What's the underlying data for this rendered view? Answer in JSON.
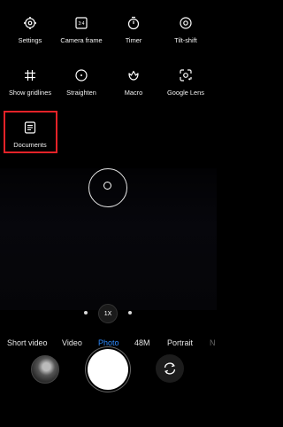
{
  "settings_grid": {
    "row1": [
      {
        "label": "Settings",
        "icon": "gear-icon"
      },
      {
        "label": "Camera frame",
        "icon": "aspect-ratio-icon",
        "icon_text": "3:4"
      },
      {
        "label": "Timer",
        "icon": "timer-icon"
      },
      {
        "label": "Tilt-shift",
        "icon": "tilt-shift-icon"
      }
    ],
    "row2": [
      {
        "label": "Show gridlines",
        "icon": "grid-icon"
      },
      {
        "label": "Straighten",
        "icon": "straighten-icon"
      },
      {
        "label": "Macro",
        "icon": "macro-flower-icon"
      },
      {
        "label": "Google Lens",
        "icon": "google-lens-icon"
      }
    ],
    "row3": [
      {
        "label": "Documents",
        "icon": "document-icon"
      }
    ]
  },
  "zoom": {
    "label": "1X"
  },
  "modes": {
    "items": [
      "Short video",
      "Video",
      "Photo",
      "48M",
      "Portrait",
      "N"
    ],
    "active": "Photo"
  },
  "colors": {
    "accent": "#2f8cff",
    "highlight": "#e32228"
  }
}
